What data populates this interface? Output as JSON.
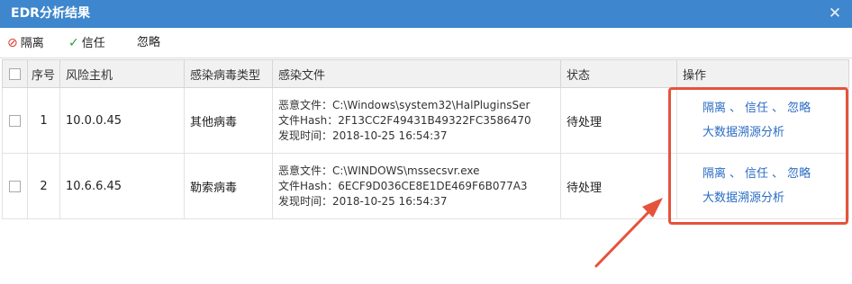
{
  "window": {
    "title": "EDR分析结果",
    "close_icon": "close-icon"
  },
  "toolbar": {
    "isolate": {
      "label": "隔离",
      "icon": "ban-icon",
      "color": "#d83b2b"
    },
    "trust": {
      "label": "信任",
      "icon": "check-icon",
      "color": "#2e9a3e"
    },
    "ignore": {
      "label": "忽略"
    }
  },
  "table": {
    "headers": [
      "序号",
      "风险主机",
      "感染病毒类型",
      "感染文件",
      "状态",
      "操作"
    ],
    "rows": [
      {
        "index": "1",
        "host": "10.0.0.45",
        "virus_type": "其他病毒",
        "file_line1": "恶意文件：C:\\Windows\\system32\\HalPluginsSer",
        "file_line2": "文件Hash：2F13CC2F49431B49322FC3586470",
        "file_line3": "发现时间：2018-10-25 16:54:37",
        "status": "待处理",
        "ops": {
          "isolate": "隔离",
          "trust": "信任",
          "ignore": "忽略",
          "trace": "大数据溯源分析",
          "sep": "、"
        }
      },
      {
        "index": "2",
        "host": "10.6.6.45",
        "virus_type": "勒索病毒",
        "file_line1": "恶意文件：C:\\WINDOWS\\mssecsvr.exe",
        "file_line2": "文件Hash：6ECF9D036CE8E1DE469F6B077A3",
        "file_line3": "发现时间：2018-10-25 16:54:37",
        "status": "待处理",
        "ops": {
          "isolate": "隔离",
          "trust": "信任",
          "ignore": "忽略",
          "trace": "大数据溯源分析",
          "sep": "、"
        }
      }
    ]
  },
  "colors": {
    "titlebar": "#3e86cd",
    "link": "#2b6cc4",
    "annotation": "#e5533b"
  }
}
